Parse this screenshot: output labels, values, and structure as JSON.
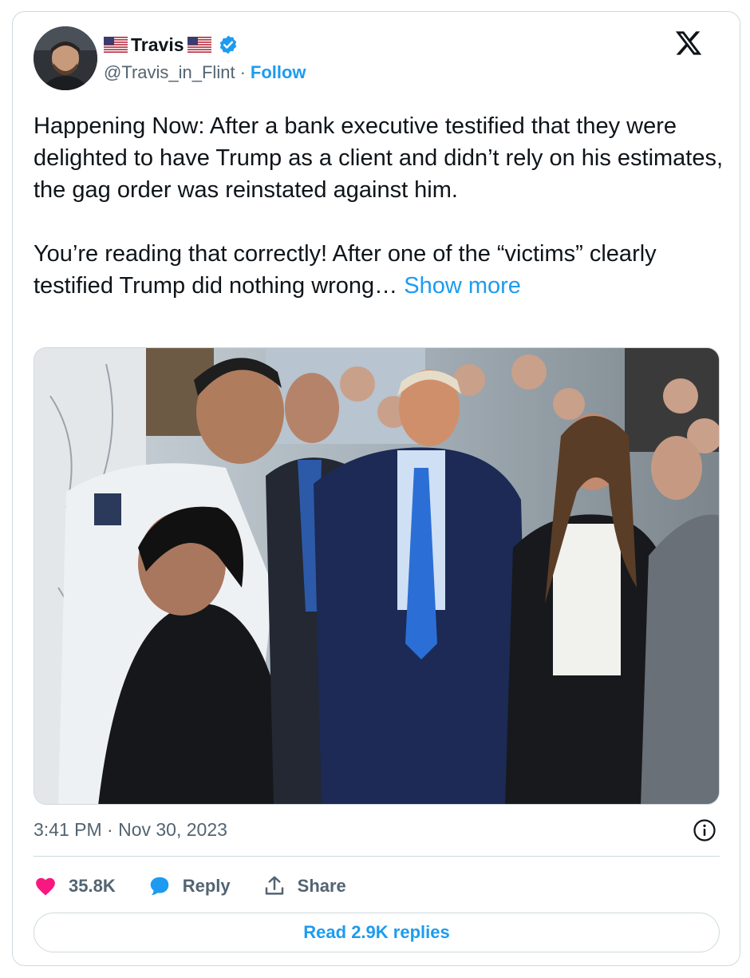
{
  "author": {
    "display_name": "Travis",
    "handle": "@Travis_in_Flint",
    "separator": "·",
    "follow_label": "Follow",
    "verified": true,
    "flag_icon": "us-flag-icon"
  },
  "tweet": {
    "paragraph1": "Happening Now:  After a bank executive testified that they were delighted to have Trump as a client and didn’t rely on his estimates, the gag order was reinstated against him.",
    "paragraph2": "You’re reading that correctly!  After one of the “victims” clearly testified Trump did nothing wrong…",
    "show_more_label": "Show more",
    "timestamp": "3:41 PM · Nov 30, 2023"
  },
  "actions": {
    "likes": "35.8K",
    "reply_label": "Reply",
    "share_label": "Share",
    "read_replies_label": "Read 2.9K replies"
  },
  "colors": {
    "accent": "#1d9bf0",
    "like": "#f91880",
    "text": "#0f1419",
    "muted": "#536471",
    "border": "#cfd9de"
  }
}
